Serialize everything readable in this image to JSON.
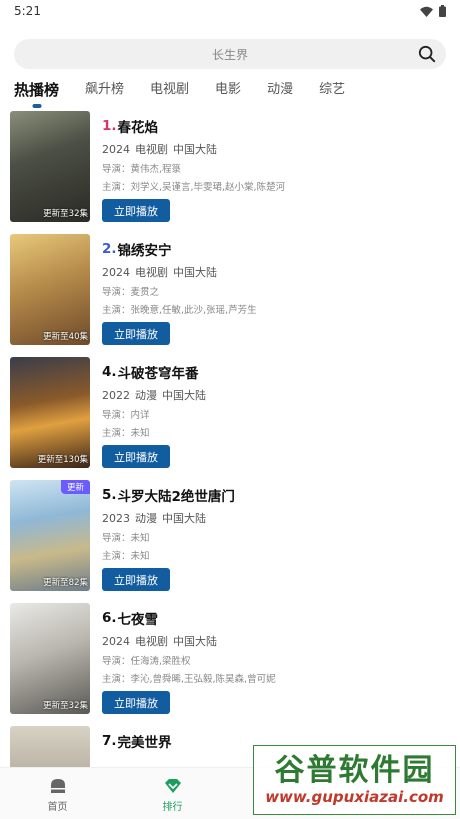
{
  "status": {
    "time": "5:21"
  },
  "search": {
    "placeholder": "长生界"
  },
  "tabs": [
    {
      "label": "热播榜"
    },
    {
      "label": "飙升榜"
    },
    {
      "label": "电视剧"
    },
    {
      "label": "电影"
    },
    {
      "label": "动漫"
    },
    {
      "label": "综艺"
    }
  ],
  "colors": {
    "accent": "#125da0",
    "nav_active": "#1e9e5e",
    "rank1": "#d6336c",
    "rank2": "#3b5bdb"
  },
  "items": [
    {
      "rank": "1.",
      "name": "春花焰",
      "year": "2024",
      "type": "电视剧",
      "region": "中国大陆",
      "director": "导演：黄伟杰,程箓",
      "cast": "主演：刘学义,吴谨言,毕雯珺,赵小棠,陈楚河",
      "episodes": "更新至32集",
      "play": "立即播放"
    },
    {
      "rank": "2.",
      "name": "锦绣安宁",
      "year": "2024",
      "type": "电视剧",
      "region": "中国大陆",
      "director": "导演：麦贯之",
      "cast": "主演：张晚意,任敏,此沙,张瑶,芦芳生",
      "episodes": "更新至40集",
      "play": "立即播放"
    },
    {
      "rank": "4.",
      "name": "斗破苍穹年番",
      "year": "2022",
      "type": "动漫",
      "region": "中国大陆",
      "director": "导演：内详",
      "cast": "主演：未知",
      "episodes": "更新至130集",
      "play": "立即播放"
    },
    {
      "rank": "5.",
      "name": "斗罗大陆2绝世唐门",
      "year": "2023",
      "type": "动漫",
      "region": "中国大陆",
      "director": "导演：未知",
      "cast": "主演：未知",
      "episodes": "更新至82集",
      "badge": "更新",
      "play": "立即播放"
    },
    {
      "rank": "6.",
      "name": "七夜雪",
      "year": "2024",
      "type": "电视剧",
      "region": "中国大陆",
      "director": "导演：任海涛,梁胜权",
      "cast": "主演：李沁,曾舜晞,王弘毅,陈昊森,曾可妮",
      "episodes": "更新至32集",
      "play": "立即播放"
    },
    {
      "rank": "7.",
      "name": "完美世界"
    }
  ],
  "nav": [
    {
      "label": "首页",
      "icon": "home-icon"
    },
    {
      "label": "排行",
      "icon": "rank-icon"
    }
  ],
  "watermark": {
    "cn": "谷普软件园",
    "url": "www.gupuxiazai.com"
  }
}
